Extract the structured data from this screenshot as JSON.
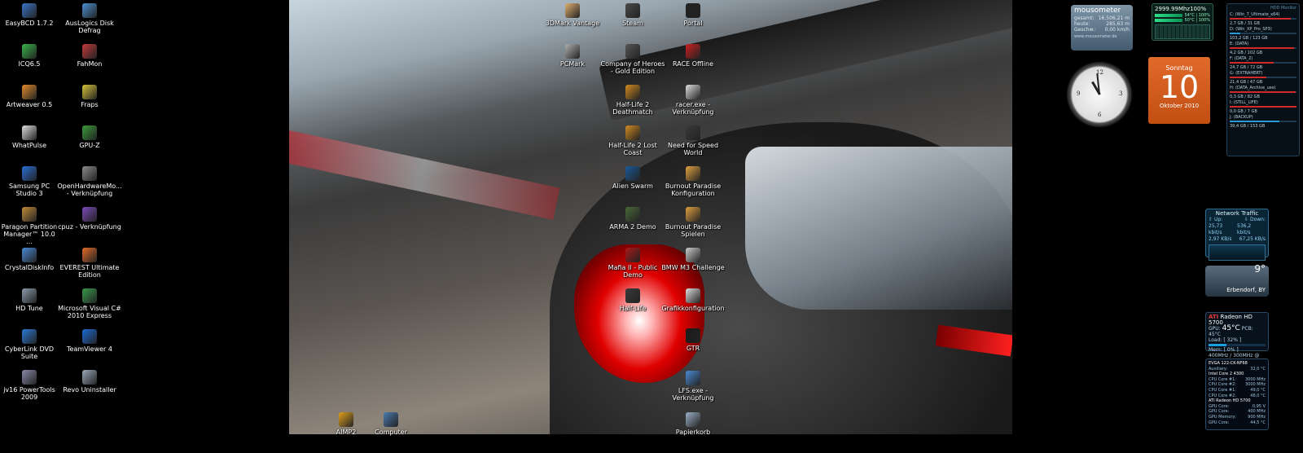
{
  "left_icons": [
    {
      "label": "EasyBCD 1.7.2",
      "icon": "easybcd-icon",
      "color": "#3a74c8"
    },
    {
      "label": "AusLogics Disk Defrag",
      "icon": "defrag-icon",
      "color": "#4a8fd1"
    },
    {
      "label": "ICQ6.5",
      "icon": "icq-icon",
      "color": "#3ab54a"
    },
    {
      "label": "FahMon",
      "icon": "fahmon-icon",
      "color": "#c23a3a"
    },
    {
      "label": "Artweaver 0.5",
      "icon": "artweaver-icon",
      "color": "#e08a2a"
    },
    {
      "label": "Fraps",
      "icon": "fraps-icon",
      "color": "#d6c23a"
    },
    {
      "label": "WhatPulse",
      "icon": "whatpulse-icon",
      "color": "#dddddd"
    },
    {
      "label": "GPU-Z",
      "icon": "gpuz-icon",
      "color": "#3a9a3a"
    },
    {
      "label": "Samsung PC Studio 3",
      "icon": "samsung-icon",
      "color": "#2a6fd6"
    },
    {
      "label": "OpenHardwareMo... - Verknüpfung",
      "icon": "openhardware-icon",
      "color": "#8a8a8a"
    },
    {
      "label": "Paragon Partition Manager™ 10.0 ...",
      "icon": "paragon-icon",
      "color": "#c28a3a"
    },
    {
      "label": "cpuz - Verknüpfung",
      "icon": "cpuz-icon",
      "color": "#7a4ab8"
    },
    {
      "label": "CrystalDiskInfo",
      "icon": "crystaldisk-icon",
      "color": "#4a8ad6"
    },
    {
      "label": "EVEREST Ultimate Edition",
      "icon": "everest-icon",
      "color": "#e06a2a"
    },
    {
      "label": "HD Tune",
      "icon": "hdtune-icon",
      "color": "#8a9aaa"
    },
    {
      "label": "Microsoft Visual C# 2010 Express",
      "icon": "visualcsharp-icon",
      "color": "#3a9a4a"
    },
    {
      "label": "CyberLink DVD Suite",
      "icon": "cyberlink-icon",
      "color": "#2a7ad6"
    },
    {
      "label": "TeamViewer 4",
      "icon": "teamviewer-icon",
      "color": "#1a6ad6"
    },
    {
      "label": "jv16 PowerTools 2009",
      "icon": "jv16-icon",
      "color": "#8a8aa8"
    },
    {
      "label": "Revo Uninstaller",
      "icon": "revo-icon",
      "color": "#9aaaba"
    }
  ],
  "wall_icons": [
    {
      "label": "3DMark Vantage",
      "icon": "3dmark-icon",
      "color": "#e0b070"
    },
    {
      "label": "Steam",
      "icon": "steam-icon",
      "color": "#4a4a4a"
    },
    {
      "label": "Portal",
      "icon": "portal-icon",
      "color": "#222222"
    },
    {
      "label": "PCMark",
      "icon": "pcmark-icon",
      "color": "#b0b0b0"
    },
    {
      "label": "Company of Heroes - Gold Edition",
      "icon": "coh-icon",
      "color": "#555555"
    },
    {
      "label": "RACE Offline",
      "icon": "race-icon",
      "color": "#cc2020"
    },
    {
      "label": "Half-Life 2 Deathmatch",
      "icon": "hl2dm-icon",
      "color": "#d08a20"
    },
    {
      "label": "racer.exe - Verknüpfung",
      "icon": "racer-icon",
      "color": "#dddddd"
    },
    {
      "label": "Half-Life 2 Lost Coast",
      "icon": "hl2lc-icon",
      "color": "#d08a20"
    },
    {
      "label": "Need for Speed World",
      "icon": "nfsw-icon",
      "color": "#3a3a3a"
    },
    {
      "label": "Alien Swarm",
      "icon": "alienswarm-icon",
      "color": "#1a5a9a"
    },
    {
      "label": "Burnout Paradise Konfiguration",
      "icon": "burnout-config-icon",
      "color": "#e0a040"
    },
    {
      "label": "ARMA 2 Demo",
      "icon": "arma2-icon",
      "color": "#4a6a3a"
    },
    {
      "label": "Burnout Paradise Spielen",
      "icon": "burnout-icon",
      "color": "#e0a040"
    },
    {
      "label": "Mafia II - Public Demo",
      "icon": "mafia2-icon",
      "color": "#aa1a1a"
    },
    {
      "label": "BMW M3 Challenge",
      "icon": "bmw-icon",
      "color": "#cccccc"
    },
    {
      "label": "Half-Life",
      "icon": "halflife-icon",
      "color": "#3a3a3a"
    },
    {
      "label": "Grafikkonfiguration",
      "icon": "grafik-icon",
      "color": "#dddddd"
    },
    {
      "label": "GTR",
      "icon": "gtr-icon",
      "color": "#1a1a1a"
    },
    {
      "label": "LFS.exe - Verknüpfung",
      "icon": "lfs-icon",
      "color": "#4a8ad6"
    },
    {
      "label": "AIMP2",
      "icon": "aimp2-icon",
      "color": "#e0a020"
    },
    {
      "label": "Computer",
      "icon": "computer-icon",
      "color": "#4a7ab0"
    },
    {
      "label": "Papierkorb",
      "icon": "recycle-bin-icon",
      "color": "#9ab0c8"
    }
  ],
  "mousometer": {
    "title": "mousometer",
    "rows": [
      {
        "k": "gesamt:",
        "v": "16.506,21 m"
      },
      {
        "k": "heute:",
        "v": "285,63 m"
      },
      {
        "k": "Geschw.:",
        "v": "0,00 km/h"
      }
    ],
    "site": "www.mousometer.de"
  },
  "cpu_meter": {
    "header": "2999.99Mhz100%",
    "cores": [
      "54°C | 100%",
      "50°C | 100%"
    ]
  },
  "clock": {
    "hour": 10,
    "minute": 59
  },
  "calendar": {
    "weekday": "Sonntag",
    "day": "10",
    "month": "Oktober 2010"
  },
  "drives": {
    "header": "HDD Monitor",
    "items": [
      {
        "name": "C: (Win_7_Ultimate_x64)",
        "size": "2,7 GB / 31 GB",
        "fill": 0.91,
        "accent": "red"
      },
      {
        "name": "D: (Win_XP_Pro_SP3)",
        "size": "103,2 GB / 123 GB",
        "fill": 0.16,
        "accent": "blue"
      },
      {
        "name": "E: (DATA)",
        "size": "4,2 GB / 102 GB",
        "fill": 0.96,
        "accent": "red"
      },
      {
        "name": "F: (DATA_2)",
        "size": "24,7 GB / 72 GB",
        "fill": 0.66,
        "accent": "red"
      },
      {
        "name": "G: (EXTRAHERT)",
        "size": "21,4 GB / 47 GB",
        "fill": 0.55,
        "accent": "red"
      },
      {
        "name": "H: (DATA_Archive_use)",
        "size": "0,3 GB / 82 GB",
        "fill": 0.99,
        "accent": "red"
      },
      {
        "name": "I: (STILL_LIFE)",
        "size": "0,0 GB / 7 GB",
        "fill": 1.0,
        "accent": "red"
      },
      {
        "name": "J: (BACKUP)",
        "size": "39,4 GB / 153 GB",
        "fill": 0.74,
        "accent": "blue"
      }
    ]
  },
  "network": {
    "title": "Network Traffic",
    "up_label": "Up:",
    "down_label": "Down:",
    "up_rate": "25,73 kbit/s",
    "down_rate": "536,2 kbit/s",
    "up_total": "2,97 KB/s",
    "down_total": "67,25 KB/s"
  },
  "weather": {
    "temp": "9°",
    "city": "Erbendorf, BY"
  },
  "gpu": {
    "brand": "ATI",
    "name": "Radeon HD 5700",
    "gpu_temp_label": "GPU:",
    "gpu_temp": "45°C",
    "pcb_temp": "PCB: 45°C",
    "load_label": "Load: [ 32% ]",
    "load_fill": 0.32,
    "mem_label": "Mem: [ 0% ]",
    "mem_fill": 0.0,
    "clocks": "400MHz / 300MHz @ x16"
  },
  "evga": {
    "title": "EVGA 122-CK-NF68",
    "auxiliary_label": "Auxiliary:",
    "auxiliary": "32,0 °C",
    "cpu_section": "Intel Core 2 4300",
    "cpu_rows": [
      {
        "k": "CPU Core #1:",
        "v": "3000 MHz"
      },
      {
        "k": "CPU Core #2:",
        "v": "3000 MHz"
      },
      {
        "k": "CPU Core #1:",
        "v": "49,0 °C"
      },
      {
        "k": "CPU Core #2:",
        "v": "48,0 °C"
      }
    ],
    "gpu_section": "ATI Radeon HD 5700",
    "gpu_rows": [
      {
        "k": "GPU Core:",
        "v": "0,95 V"
      },
      {
        "k": "GPU Core:",
        "v": "400 MHz"
      },
      {
        "k": "GPU Memory:",
        "v": "900 MHz"
      },
      {
        "k": "GPU Core:",
        "v": "44,5 °C"
      }
    ]
  }
}
